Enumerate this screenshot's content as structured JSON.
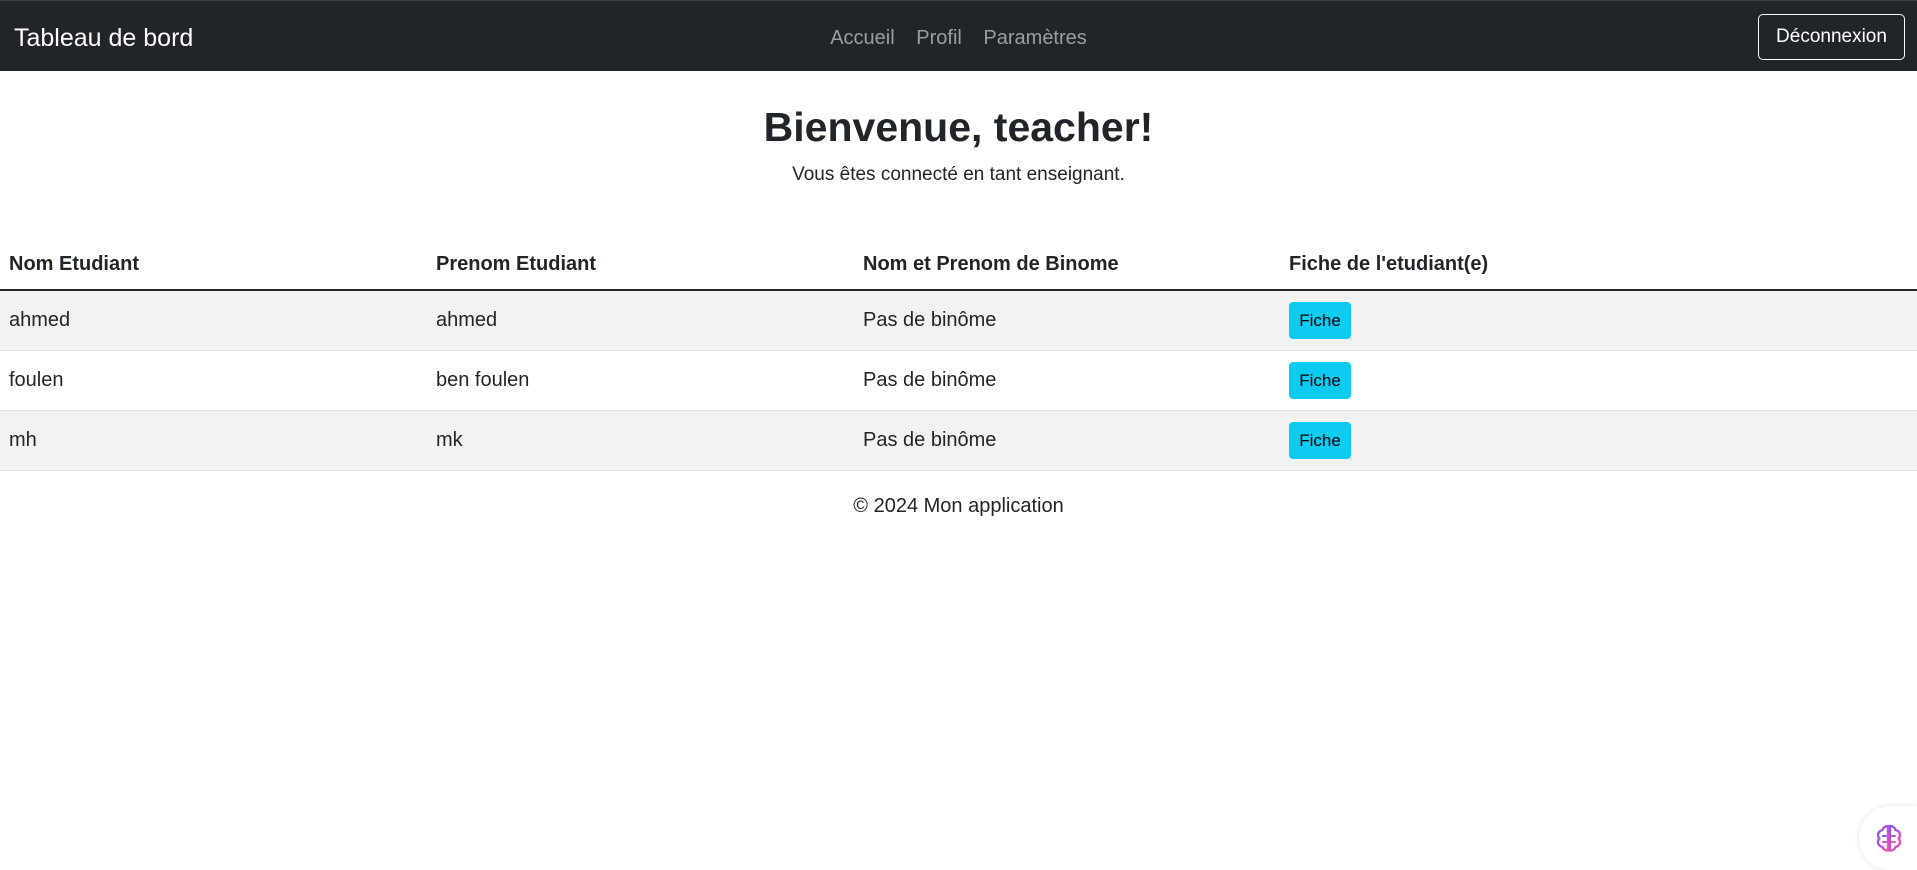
{
  "navbar": {
    "brand": "Tableau de bord",
    "links": [
      "Accueil",
      "Profil",
      "Paramètres"
    ],
    "logout_label": "Déconnexion"
  },
  "hero": {
    "title": "Bienvenue, teacher!",
    "subtitle": "Vous êtes connecté en tant enseignant."
  },
  "table": {
    "headers": [
      "Nom Etudiant",
      "Prenom Etudiant",
      "Nom et Prenom de Binome",
      "Fiche de l'etudiant(e)"
    ],
    "rows": [
      {
        "nom": "ahmed",
        "prenom": "ahmed",
        "binome": "Pas de binôme",
        "action": "Fiche"
      },
      {
        "nom": "foulen",
        "prenom": "ben foulen",
        "binome": "Pas de binôme",
        "action": "Fiche"
      },
      {
        "nom": "mh",
        "prenom": "mk",
        "binome": "Pas de binôme",
        "action": "Fiche"
      }
    ]
  },
  "footer": {
    "text": "© 2024 Mon application"
  },
  "colors": {
    "navbar_bg": "#212529",
    "info_button": "#0dcaf0",
    "stripe": "#f2f2f2"
  },
  "icons": {
    "assistant": "brain-icon"
  }
}
